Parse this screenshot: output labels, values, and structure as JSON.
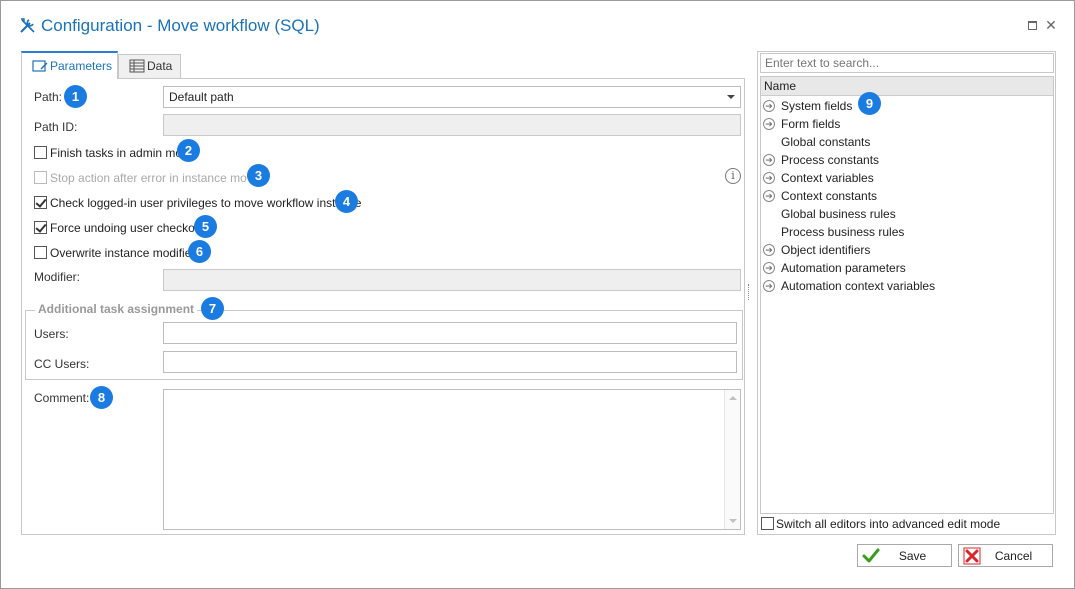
{
  "window": {
    "title": "Configuration - Move workflow (SQL)",
    "icons": {
      "title": "tools-icon",
      "maximize": "maximize-icon",
      "close": "close-icon"
    }
  },
  "tabs": [
    {
      "label": "Parameters",
      "icon": "parameters-icon",
      "active": true
    },
    {
      "label": "Data",
      "icon": "data-table-icon",
      "active": false
    }
  ],
  "form": {
    "path": {
      "label": "Path:",
      "value": "Default path"
    },
    "path_id": {
      "label": "Path ID:",
      "value": ""
    },
    "finish_tasks": {
      "label": "Finish tasks in admin mode",
      "checked": false
    },
    "stop_action": {
      "label": "Stop action after error in instance move",
      "checked": false,
      "disabled": true
    },
    "check_privileges": {
      "label": "Check logged-in user privileges to move workflow instance",
      "checked": true
    },
    "force_undo": {
      "label": "Force undoing user checkout",
      "checked": true
    },
    "overwrite_modifier": {
      "label": "Overwrite instance modifier",
      "checked": false
    },
    "modifier": {
      "label": "Modifier:",
      "value": ""
    },
    "additional_group": {
      "title": "Additional task assignment",
      "users": {
        "label": "Users:",
        "value": ""
      },
      "cc_users": {
        "label": "CC Users:",
        "value": ""
      }
    },
    "comment": {
      "label": "Comment:",
      "value": ""
    }
  },
  "badges": [
    "1",
    "2",
    "3",
    "4",
    "5",
    "6",
    "7",
    "8",
    "9"
  ],
  "right_panel": {
    "search_placeholder": "Enter text to search...",
    "header": "Name",
    "items": [
      {
        "label": "System fields",
        "expandable": true
      },
      {
        "label": "Form fields",
        "expandable": true
      },
      {
        "label": "Global constants",
        "expandable": false
      },
      {
        "label": "Process constants",
        "expandable": true
      },
      {
        "label": "Context variables",
        "expandable": true
      },
      {
        "label": "Context constants",
        "expandable": true
      },
      {
        "label": "Global business rules",
        "expandable": false
      },
      {
        "label": "Process business rules",
        "expandable": false
      },
      {
        "label": "Object identifiers",
        "expandable": true
      },
      {
        "label": "Automation parameters",
        "expandable": true
      },
      {
        "label": "Automation context variables",
        "expandable": true
      }
    ],
    "advanced_mode": {
      "label": "Switch all editors into advanced edit mode",
      "checked": false
    }
  },
  "buttons": {
    "save": {
      "label": "Save",
      "icon": "checkmark-icon"
    },
    "cancel": {
      "label": "Cancel",
      "icon": "cross-icon"
    }
  },
  "colors": {
    "accent": "#1a73b8",
    "badge": "#1a7be0",
    "save_icon": "#3a9b1c",
    "cancel_icon": "#d9252b"
  }
}
